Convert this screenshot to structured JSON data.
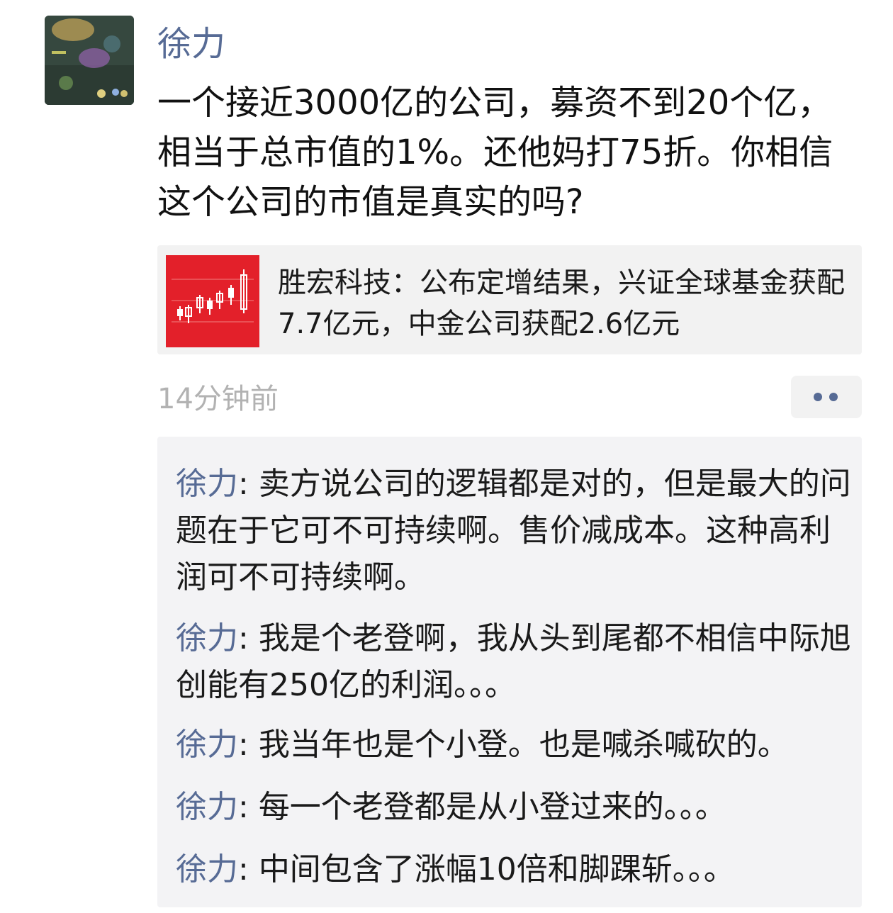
{
  "post": {
    "author": "徐力",
    "text": "一个接近3000亿的公司，募资不到20个亿，相当于总市值的1%。还他妈打75折。你相信这个公司的市值是真实的吗?",
    "avatar_icon": "game-screenshot-avatar",
    "link": {
      "thumbnail_icon": "candlestick-chart-icon",
      "thumbnail_color": "#e3202a",
      "title": "胜宏科技：公布定增结果，兴证全球基金获配7.7亿元，中金公司获配2.6亿元"
    },
    "timestamp": "14分钟前",
    "more_icon": "more-dots-icon"
  },
  "comments": [
    {
      "author": "徐力",
      "separator": ": ",
      "text": "卖方说公司的逻辑都是对的，但是最大的问题在于它可不可持续啊。售价减成本。这种高利润可不可持续啊。"
    },
    {
      "author": "徐力",
      "separator": ": ",
      "text": "我是个老登啊，我从头到尾都不相信中际旭创能有250亿的利润。。。"
    },
    {
      "author": "徐力",
      "separator": ": ",
      "text": "我当年也是个小登。也是喊杀喊砍的。"
    },
    {
      "author": "徐力",
      "separator": ": ",
      "text": "每一个老登都是从小登过来的。。。"
    },
    {
      "author": "徐力",
      "separator": ": ",
      "text": "中间包含了涨幅10倍和脚踝斩。。。"
    }
  ],
  "colors": {
    "name_blue": "#576b95",
    "timestamp_gray": "#b2b2b2",
    "comment_bg": "#f3f3f5",
    "card_bg": "#f2f2f2"
  }
}
